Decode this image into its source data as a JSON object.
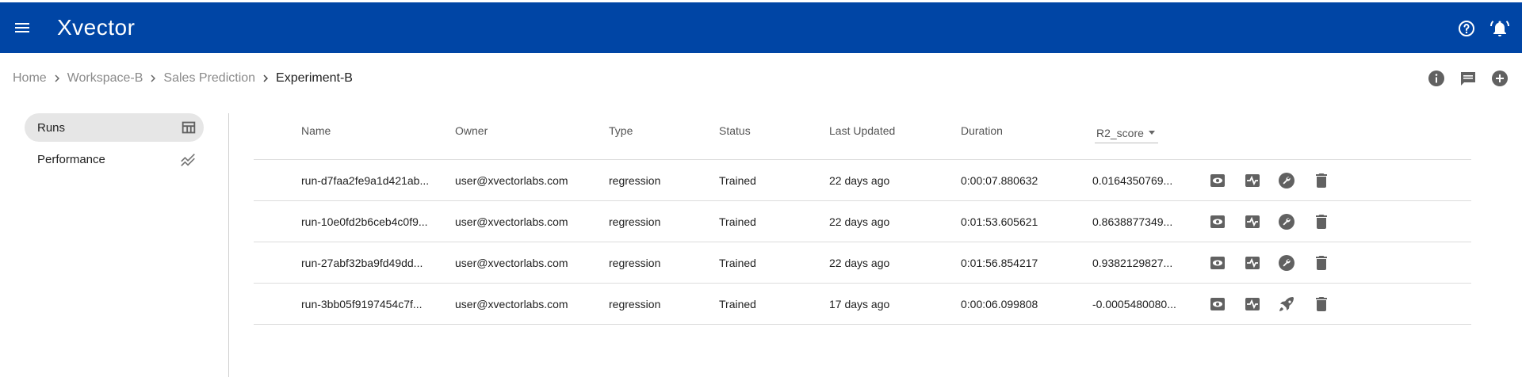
{
  "app": {
    "title": "Xvector"
  },
  "breadcrumb": {
    "items": [
      "Home",
      "Workspace-B",
      "Sales Prediction",
      "Experiment-B"
    ]
  },
  "sidebar": {
    "items": [
      {
        "label": "Runs",
        "icon": "table-icon",
        "active": true
      },
      {
        "label": "Performance",
        "icon": "trending-chart-icon",
        "active": false
      }
    ]
  },
  "table": {
    "columns": [
      "Name",
      "Owner",
      "Type",
      "Status",
      "Last Updated",
      "Duration"
    ],
    "sort_select": "R2_score",
    "rows": [
      {
        "name": "run-d7faa2fe9a1d421ab...",
        "owner": "user@xvectorlabs.com",
        "type": "regression",
        "status": "Trained",
        "last_updated": "22 days ago",
        "duration": "0:00:07.880632",
        "r2": "0.0164350769...",
        "action_icons": [
          "eye-icon",
          "pulse-icon",
          "wrench-icon",
          "trash-icon"
        ]
      },
      {
        "name": "run-10e0fd2b6ceb4c0f9...",
        "owner": "user@xvectorlabs.com",
        "type": "regression",
        "status": "Trained",
        "last_updated": "22 days ago",
        "duration": "0:01:53.605621",
        "r2": "0.8638877349...",
        "action_icons": [
          "eye-icon",
          "pulse-icon",
          "wrench-icon",
          "trash-icon"
        ]
      },
      {
        "name": "run-27abf32ba9fd49dd...",
        "owner": "user@xvectorlabs.com",
        "type": "regression",
        "status": "Trained",
        "last_updated": "22 days ago",
        "duration": "0:01:56.854217",
        "r2": "0.9382129827...",
        "action_icons": [
          "eye-icon",
          "pulse-icon",
          "wrench-icon",
          "trash-icon"
        ]
      },
      {
        "name": "run-3bb05f9197454c7f...",
        "owner": "user@xvectorlabs.com",
        "type": "regression",
        "status": "Trained",
        "last_updated": "17 days ago",
        "duration": "0:00:06.099808",
        "r2": "-0.0005480080...",
        "action_icons": [
          "eye-icon",
          "pulse-icon",
          "rocket-icon",
          "trash-icon"
        ]
      }
    ]
  },
  "colors": {
    "header_bg": "#0045a5",
    "active_nav_bg": "#e6e6e6",
    "icon_gray": "#616161",
    "breadcrumb_muted": "#8a8a8a"
  }
}
